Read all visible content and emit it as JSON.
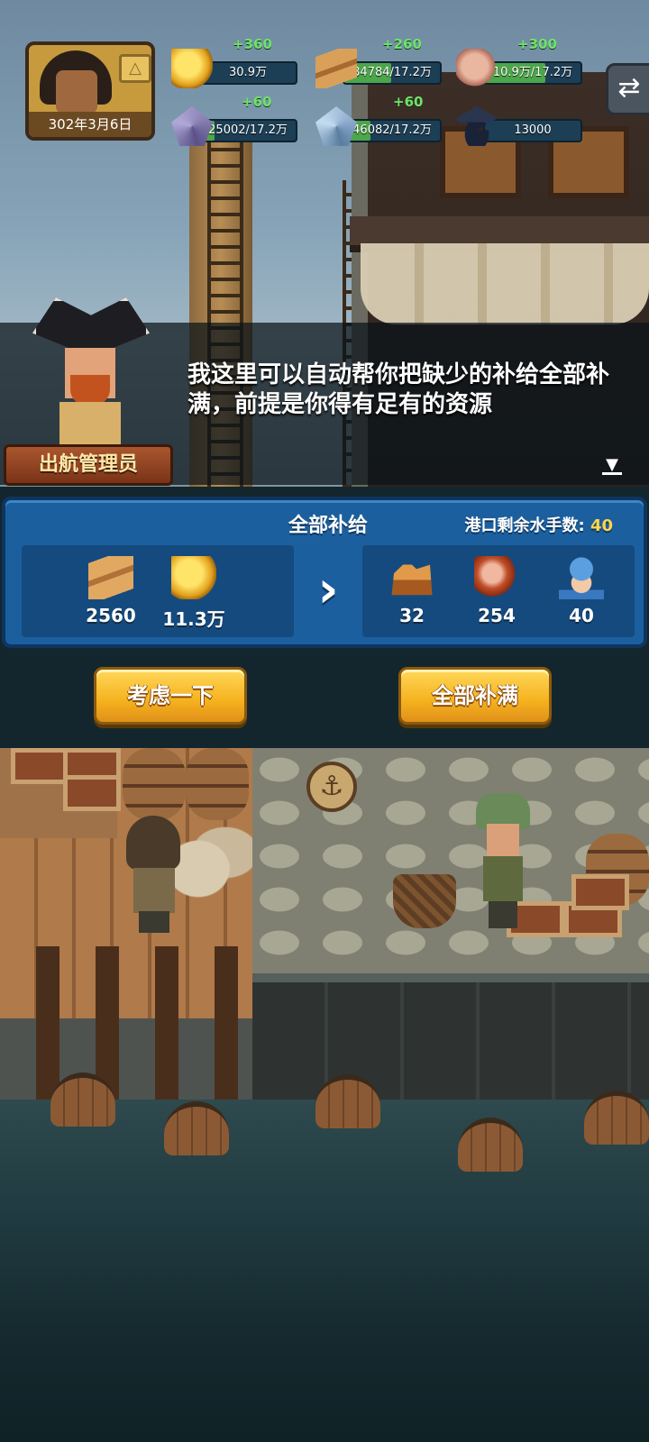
{
  "hud": {
    "date": "302年3月6日",
    "rank_icon": "triangle-rank-icon",
    "resources": [
      {
        "name": "coin",
        "icon": "coin-icon",
        "delta": "+360",
        "value": "30.9万",
        "fill": 0
      },
      {
        "name": "wood",
        "icon": "wood-plank-icon",
        "delta": "+260",
        "value": "84784/17.2万",
        "fill": 0.49
      },
      {
        "name": "meat",
        "icon": "meat-icon",
        "delta": "+300",
        "value": "10.9万/17.2万",
        "fill": 0.63
      },
      {
        "name": "crystal",
        "icon": "purple-crystal-icon",
        "delta": "+60",
        "value": "25002/17.2万",
        "fill": 0.15
      },
      {
        "name": "ice",
        "icon": "blue-crystal-icon",
        "delta": "+60",
        "value": "46082/17.2万",
        "fill": 0.27
      },
      {
        "name": "knowledge",
        "icon": "graduation-cap-icon",
        "delta": "",
        "value": "13000",
        "fill": 0
      }
    ],
    "swap_icon": "swap-arrows-icon"
  },
  "dialog": {
    "npc_name": "出航管理员",
    "text": "我这里可以自动帮你把缺少的补给全部补满，前提是你得有足有的资源",
    "next_icon": "next-arrow-icon"
  },
  "panel": {
    "title": "全部补给",
    "sailor_label": "港口剩余水手数:",
    "sailor_count": "40",
    "cost": [
      {
        "icon": "wood-plank-icon",
        "qty": "2560"
      },
      {
        "icon": "coin-icon",
        "qty": "11.3万"
      }
    ],
    "arrow_icon": "chevron-right-icon",
    "gain": [
      {
        "icon": "supply-icon",
        "qty": "32"
      },
      {
        "icon": "ham-icon",
        "qty": "254"
      },
      {
        "icon": "sailor-icon",
        "qty": "40"
      }
    ]
  },
  "buttons": {
    "consider": "考虑一下",
    "fill_all": "全部补满"
  },
  "colors": {
    "panel_blue": "#1b5f9e",
    "button_gold": "#f5b21e",
    "delta_green": "#6ee36a",
    "sailor_count_yellow": "#ffd44a"
  }
}
